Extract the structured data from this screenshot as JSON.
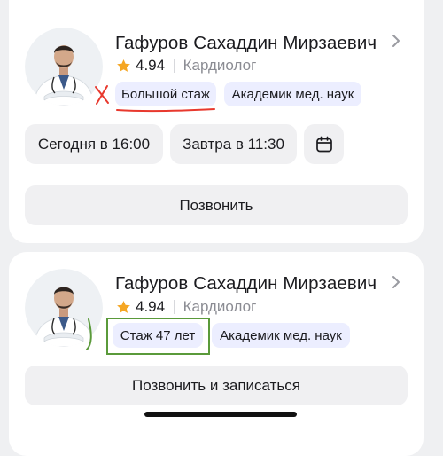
{
  "cards": [
    {
      "doctor_name": "Гафуров Сахаддин Мирзаевич",
      "rating": "4.94",
      "specialty": "Кардиолог",
      "tags": [
        "Большой стаж",
        "Академик мед. наук"
      ],
      "slots": [
        "Сегодня в 16:00",
        "Завтра в 11:30"
      ],
      "action_label": "Позвонить"
    },
    {
      "doctor_name": "Гафуров Сахаддин Мирзаевич",
      "rating": "4.94",
      "specialty": "Кардиолог",
      "tags": [
        "Стаж 47 лет",
        "Академик мед. наук"
      ],
      "action_label": "Позвонить и записаться"
    }
  ],
  "colors": {
    "star": "#f5a623",
    "tag_bg": "#eceeff",
    "button_bg": "#f0f0f2",
    "annotation_red": "#e8392e",
    "annotation_green": "#5a9a3a"
  },
  "icons": {
    "chevron": "chevron-right-icon",
    "star": "star-icon",
    "calendar": "calendar-icon"
  }
}
